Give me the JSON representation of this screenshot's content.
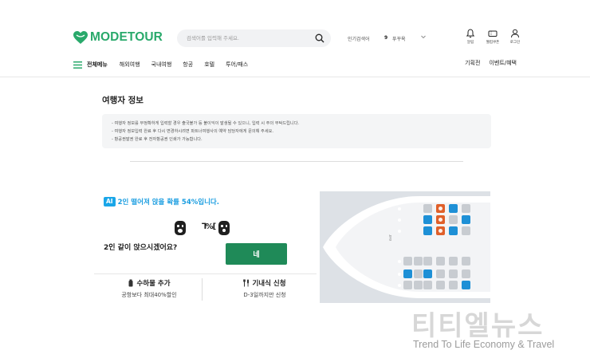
{
  "header": {
    "logo": "MODETOUR",
    "search_placeholder": "검색어를 입력해 주세요.",
    "popular_label": "인기검색어",
    "popular_rank": "9",
    "popular_word": "푸꾸옥",
    "icons": [
      {
        "name": "bell-icon",
        "label": "알림"
      },
      {
        "name": "coupon-icon",
        "label": "웰컴쿠폰"
      },
      {
        "name": "user-icon",
        "label": "로그인"
      }
    ]
  },
  "nav": {
    "menu_label": "전체메뉴",
    "items": [
      "해외여행",
      "국내여행",
      "항공",
      "호텔",
      "투어/패스"
    ],
    "right_items": [
      "기획전",
      "이벤트/혜택"
    ]
  },
  "traveler": {
    "title": "여행자 정보",
    "notices": [
      "- 여행자 정보를 부정확하게 입력할 경우 출국불가 등 불이익이 발생될 수 있으니, 입력 시 주의 부탁드립니다.",
      "- 여행자 정보입력 완료 후 다시 변경하시려면 파트너여행사의 예약 담당자에게 문의해 주세요.",
      "- 항공권발권 완료 후 전자항공권 인쇄가 가능합니다."
    ]
  },
  "ai_widget": {
    "badge": "AI",
    "message": "2인 떨어져 앉을 확률 54%입니다.",
    "gap_glyph": "⅂%[",
    "question": "2인 같이 앉으시겠어요?",
    "yes_label": "네"
  },
  "cards": [
    {
      "icon": "bottle-icon",
      "title": "수하물 추가",
      "sub": "공항보다 최대40%할인"
    },
    {
      "icon": "cutlery-icon",
      "title": "기내식 신청",
      "sub": "D-3일까지만 신청"
    }
  ],
  "seatmap": {
    "exit_label": "EXIT",
    "seat_colors": {
      "available": "#1e90d6",
      "occupied": "#c8ccd1",
      "selected": "#e0602a"
    },
    "rows": [
      [
        "grey",
        "orange",
        "blue",
        "grey"
      ],
      [
        "blue",
        "orange",
        "grey",
        "blue"
      ],
      [
        "blue",
        "orange",
        "blue",
        "grey"
      ],
      [
        "grey",
        "grey",
        "grey",
        "grey"
      ],
      [
        "blue",
        "grey",
        "grey",
        "grey"
      ],
      [
        "grey",
        "grey",
        "grey",
        "blue"
      ]
    ],
    "left_seats": [
      [
        null,
        null
      ],
      [
        null,
        null
      ],
      [
        null,
        null
      ],
      [
        "grey",
        "grey"
      ],
      [
        "blue",
        "grey"
      ],
      [
        "grey",
        "grey"
      ]
    ]
  },
  "watermark": {
    "title": "티티엘뉴스",
    "subtitle": "Trend To Life Economy & Travel"
  },
  "colors": {
    "brand": "#29a96b",
    "accent": "#1aa6e8",
    "button": "#1f8a58"
  }
}
